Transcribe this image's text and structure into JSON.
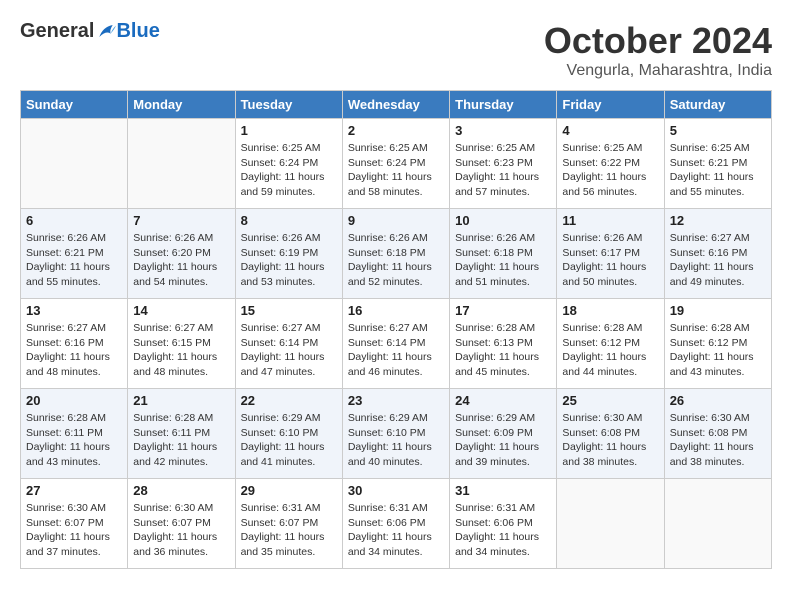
{
  "header": {
    "logo_general": "General",
    "logo_blue": "Blue",
    "month_title": "October 2024",
    "location": "Vengurla, Maharashtra, India"
  },
  "days_of_week": [
    "Sunday",
    "Monday",
    "Tuesday",
    "Wednesday",
    "Thursday",
    "Friday",
    "Saturday"
  ],
  "weeks": [
    {
      "alt": false,
      "days": [
        {
          "num": "",
          "empty": true
        },
        {
          "num": "",
          "empty": true
        },
        {
          "num": "1",
          "sunrise": "6:25 AM",
          "sunset": "6:24 PM",
          "daylight": "11 hours and 59 minutes."
        },
        {
          "num": "2",
          "sunrise": "6:25 AM",
          "sunset": "6:24 PM",
          "daylight": "11 hours and 58 minutes."
        },
        {
          "num": "3",
          "sunrise": "6:25 AM",
          "sunset": "6:23 PM",
          "daylight": "11 hours and 57 minutes."
        },
        {
          "num": "4",
          "sunrise": "6:25 AM",
          "sunset": "6:22 PM",
          "daylight": "11 hours and 56 minutes."
        },
        {
          "num": "5",
          "sunrise": "6:25 AM",
          "sunset": "6:21 PM",
          "daylight": "11 hours and 55 minutes."
        }
      ]
    },
    {
      "alt": true,
      "days": [
        {
          "num": "6",
          "sunrise": "6:26 AM",
          "sunset": "6:21 PM",
          "daylight": "11 hours and 55 minutes."
        },
        {
          "num": "7",
          "sunrise": "6:26 AM",
          "sunset": "6:20 PM",
          "daylight": "11 hours and 54 minutes."
        },
        {
          "num": "8",
          "sunrise": "6:26 AM",
          "sunset": "6:19 PM",
          "daylight": "11 hours and 53 minutes."
        },
        {
          "num": "9",
          "sunrise": "6:26 AM",
          "sunset": "6:18 PM",
          "daylight": "11 hours and 52 minutes."
        },
        {
          "num": "10",
          "sunrise": "6:26 AM",
          "sunset": "6:18 PM",
          "daylight": "11 hours and 51 minutes."
        },
        {
          "num": "11",
          "sunrise": "6:26 AM",
          "sunset": "6:17 PM",
          "daylight": "11 hours and 50 minutes."
        },
        {
          "num": "12",
          "sunrise": "6:27 AM",
          "sunset": "6:16 PM",
          "daylight": "11 hours and 49 minutes."
        }
      ]
    },
    {
      "alt": false,
      "days": [
        {
          "num": "13",
          "sunrise": "6:27 AM",
          "sunset": "6:16 PM",
          "daylight": "11 hours and 48 minutes."
        },
        {
          "num": "14",
          "sunrise": "6:27 AM",
          "sunset": "6:15 PM",
          "daylight": "11 hours and 48 minutes."
        },
        {
          "num": "15",
          "sunrise": "6:27 AM",
          "sunset": "6:14 PM",
          "daylight": "11 hours and 47 minutes."
        },
        {
          "num": "16",
          "sunrise": "6:27 AM",
          "sunset": "6:14 PM",
          "daylight": "11 hours and 46 minutes."
        },
        {
          "num": "17",
          "sunrise": "6:28 AM",
          "sunset": "6:13 PM",
          "daylight": "11 hours and 45 minutes."
        },
        {
          "num": "18",
          "sunrise": "6:28 AM",
          "sunset": "6:12 PM",
          "daylight": "11 hours and 44 minutes."
        },
        {
          "num": "19",
          "sunrise": "6:28 AM",
          "sunset": "6:12 PM",
          "daylight": "11 hours and 43 minutes."
        }
      ]
    },
    {
      "alt": true,
      "days": [
        {
          "num": "20",
          "sunrise": "6:28 AM",
          "sunset": "6:11 PM",
          "daylight": "11 hours and 43 minutes."
        },
        {
          "num": "21",
          "sunrise": "6:28 AM",
          "sunset": "6:11 PM",
          "daylight": "11 hours and 42 minutes."
        },
        {
          "num": "22",
          "sunrise": "6:29 AM",
          "sunset": "6:10 PM",
          "daylight": "11 hours and 41 minutes."
        },
        {
          "num": "23",
          "sunrise": "6:29 AM",
          "sunset": "6:10 PM",
          "daylight": "11 hours and 40 minutes."
        },
        {
          "num": "24",
          "sunrise": "6:29 AM",
          "sunset": "6:09 PM",
          "daylight": "11 hours and 39 minutes."
        },
        {
          "num": "25",
          "sunrise": "6:30 AM",
          "sunset": "6:08 PM",
          "daylight": "11 hours and 38 minutes."
        },
        {
          "num": "26",
          "sunrise": "6:30 AM",
          "sunset": "6:08 PM",
          "daylight": "11 hours and 38 minutes."
        }
      ]
    },
    {
      "alt": false,
      "days": [
        {
          "num": "27",
          "sunrise": "6:30 AM",
          "sunset": "6:07 PM",
          "daylight": "11 hours and 37 minutes."
        },
        {
          "num": "28",
          "sunrise": "6:30 AM",
          "sunset": "6:07 PM",
          "daylight": "11 hours and 36 minutes."
        },
        {
          "num": "29",
          "sunrise": "6:31 AM",
          "sunset": "6:07 PM",
          "daylight": "11 hours and 35 minutes."
        },
        {
          "num": "30",
          "sunrise": "6:31 AM",
          "sunset": "6:06 PM",
          "daylight": "11 hours and 34 minutes."
        },
        {
          "num": "31",
          "sunrise": "6:31 AM",
          "sunset": "6:06 PM",
          "daylight": "11 hours and 34 minutes."
        },
        {
          "num": "",
          "empty": true
        },
        {
          "num": "",
          "empty": true
        }
      ]
    }
  ],
  "labels": {
    "sunrise": "Sunrise:",
    "sunset": "Sunset:",
    "daylight": "Daylight:"
  }
}
